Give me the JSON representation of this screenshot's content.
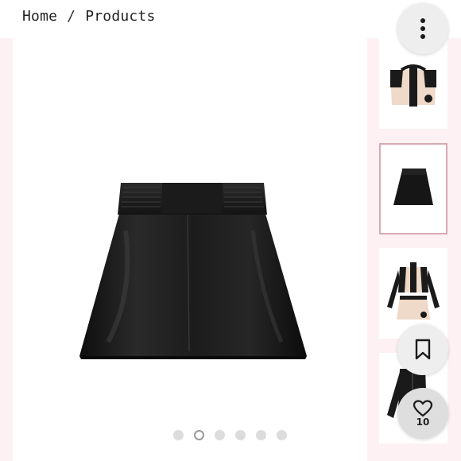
{
  "breadcrumb": {
    "home": "Home",
    "separator": "/",
    "current": "Products"
  },
  "gallery": {
    "slide_count": 6,
    "active_slide": 2,
    "thumbnails": [
      {
        "name": "thumb-jacket-back"
      },
      {
        "name": "thumb-black-skirt",
        "selected": true
      },
      {
        "name": "thumb-outfit-set"
      },
      {
        "name": "thumb-black-jacket"
      }
    ]
  },
  "actions": {
    "menu_icon": "more-vertical-icon",
    "bookmark_icon": "bookmark-icon",
    "like_icon": "heart-icon",
    "like_count": "10"
  },
  "colors": {
    "accent_pink": "#fdf1f3",
    "selected_border": "#d9a9b1",
    "leather": "#1a1a1a"
  }
}
